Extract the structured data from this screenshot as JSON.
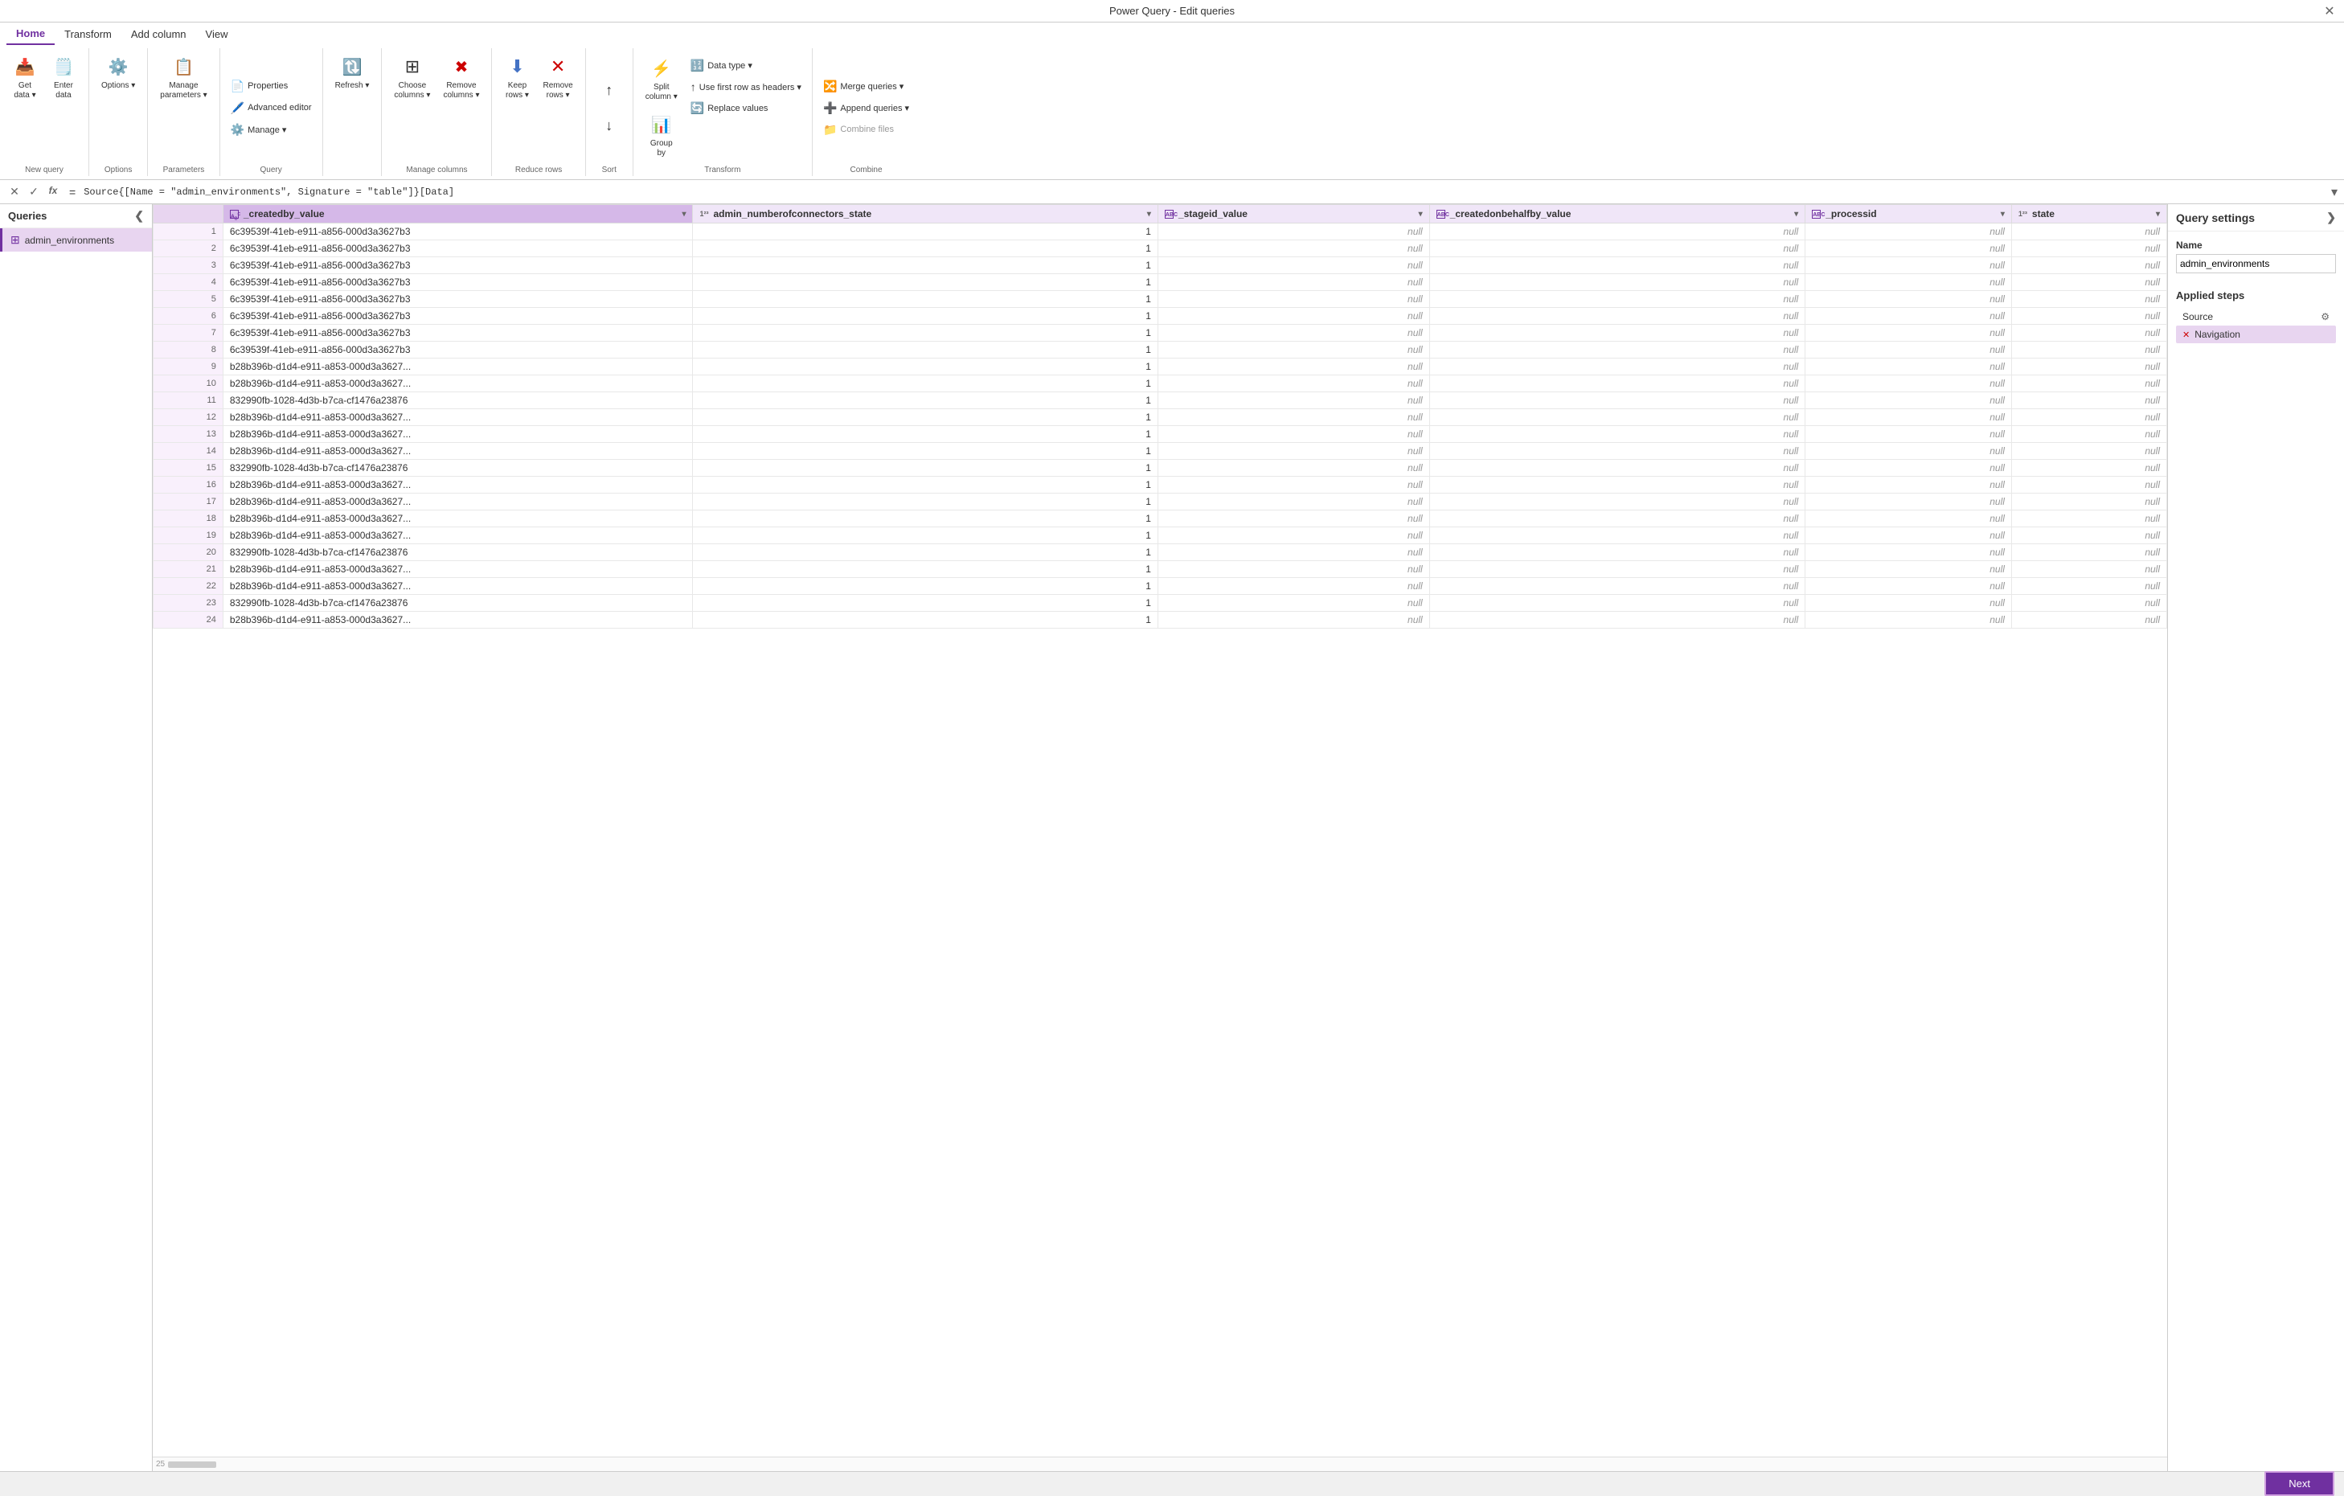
{
  "titleBar": {
    "title": "Power Query - Edit queries",
    "closeBtn": "✕"
  },
  "ribbonTabs": [
    {
      "id": "home",
      "label": "Home",
      "active": true
    },
    {
      "id": "transform",
      "label": "Transform",
      "active": false
    },
    {
      "id": "add-column",
      "label": "Add column",
      "active": false
    },
    {
      "id": "view",
      "label": "View",
      "active": false
    }
  ],
  "ribbon": {
    "groups": [
      {
        "id": "new-query",
        "label": "New query",
        "items": [
          {
            "id": "get-data",
            "icon": "📥",
            "label": "Get\ndata",
            "dropdown": true
          },
          {
            "id": "enter-data",
            "icon": "🗒️",
            "label": "Enter\ndata"
          }
        ]
      },
      {
        "id": "options",
        "label": "Options",
        "items": [
          {
            "id": "options-btn",
            "icon": "⚙️",
            "label": "Options",
            "dropdown": true
          }
        ]
      },
      {
        "id": "parameters",
        "label": "Parameters",
        "items": [
          {
            "id": "manage-parameters",
            "icon": "📋",
            "label": "Manage\nparameters",
            "dropdown": true
          }
        ]
      },
      {
        "id": "query-group",
        "label": "Query",
        "items_col1": [
          {
            "id": "properties",
            "icon": "📄",
            "label": "Properties"
          },
          {
            "id": "advanced-editor",
            "icon": "🖊️",
            "label": "Advanced editor"
          },
          {
            "id": "manage",
            "icon": "⚙️",
            "label": "Manage ▾"
          }
        ]
      },
      {
        "id": "manage-cols",
        "label": "Manage columns",
        "items": [
          {
            "id": "choose-columns",
            "icon": "🔲",
            "label": "Choose\ncolumns",
            "dropdown": true
          },
          {
            "id": "remove-columns",
            "icon": "✖️",
            "label": "Remove\ncolumns",
            "dropdown": true
          }
        ]
      },
      {
        "id": "reduce-rows",
        "label": "Reduce rows",
        "items": [
          {
            "id": "keep-rows",
            "icon": "⬇️",
            "label": "Keep\nrows",
            "dropdown": true
          },
          {
            "id": "remove-rows",
            "icon": "❌",
            "label": "Remove\nrows",
            "dropdown": true
          }
        ]
      },
      {
        "id": "sort-group",
        "label": "Sort",
        "items": [
          {
            "id": "sort-asc",
            "icon": "↑",
            "label": ""
          },
          {
            "id": "sort-desc",
            "icon": "↓",
            "label": ""
          }
        ]
      },
      {
        "id": "transform-group",
        "label": "Transform",
        "items_col1": [
          {
            "id": "split-column",
            "icon": "⚡",
            "label": "Split\ncolumn",
            "dropdown": true
          },
          {
            "id": "group-by",
            "icon": "📊",
            "label": "Group\nby"
          }
        ],
        "items_col2": [
          {
            "id": "data-type",
            "icon": "🔢",
            "label": "Data type ▾"
          },
          {
            "id": "first-row-headers",
            "icon": "↑",
            "label": "Use first row as headers ▾"
          },
          {
            "id": "replace-values",
            "icon": "🔄",
            "label": "Replace values"
          }
        ]
      },
      {
        "id": "combine-group",
        "label": "Combine",
        "items_col": [
          {
            "id": "merge-queries",
            "icon": "🔀",
            "label": "Merge queries ▾"
          },
          {
            "id": "append-queries",
            "icon": "➕",
            "label": "Append queries ▾"
          },
          {
            "id": "combine-files",
            "icon": "📁",
            "label": "Combine files"
          }
        ]
      },
      {
        "id": "refresh-group",
        "label": "",
        "items": [
          {
            "id": "refresh-btn",
            "icon": "🔃",
            "label": "Refresh",
            "dropdown": true
          }
        ]
      }
    ]
  },
  "formulaBar": {
    "cancelIcon": "✕",
    "confirmIcon": "✓",
    "functionIcon": "fx",
    "equals": "=",
    "formula": "Source{[Name = \"admin_environments\", Signature = \"table\"]}[Data]",
    "expandIcon": "▾"
  },
  "queriesPanel": {
    "title": "Queries",
    "collapseIcon": "❮",
    "items": [
      {
        "id": "admin-env",
        "icon": "⊞",
        "label": "admin_environments"
      }
    ]
  },
  "dataGrid": {
    "columns": [
      {
        "id": "createdby_value",
        "type": "ABC",
        "label": "_createdby_value"
      },
      {
        "id": "admin_numberofconnectors_state",
        "type": "123",
        "label": "admin_numberofconnectors_state"
      },
      {
        "id": "stageid_value",
        "type": "ABC",
        "label": "_stageid_value"
      },
      {
        "id": "createdonbehalfby_value",
        "type": "ABC",
        "label": "_createdonbehalfby_value"
      },
      {
        "id": "processid",
        "type": "ABC",
        "label": "_processid"
      },
      {
        "id": "state",
        "type": "123",
        "label": "state"
      }
    ],
    "rows": [
      {
        "num": 1,
        "createdby_value": "6c39539f-41eb-e911-a856-000d3a3627b3",
        "admin_numberofconnectors_state": "1",
        "stageid_value": "null",
        "createdonbehalfby_value": "null",
        "processid": "null",
        "state": "null"
      },
      {
        "num": 2,
        "createdby_value": "6c39539f-41eb-e911-a856-000d3a3627b3",
        "admin_numberofconnectors_state": "1",
        "stageid_value": "null",
        "createdonbehalfby_value": "null",
        "processid": "null",
        "state": "null"
      },
      {
        "num": 3,
        "createdby_value": "6c39539f-41eb-e911-a856-000d3a3627b3",
        "admin_numberofconnectors_state": "1",
        "stageid_value": "null",
        "createdonbehalfby_value": "null",
        "processid": "null",
        "state": "null"
      },
      {
        "num": 4,
        "createdby_value": "6c39539f-41eb-e911-a856-000d3a3627b3",
        "admin_numberofconnectors_state": "1",
        "stageid_value": "null",
        "createdonbehalfby_value": "null",
        "processid": "null",
        "state": "null"
      },
      {
        "num": 5,
        "createdby_value": "6c39539f-41eb-e911-a856-000d3a3627b3",
        "admin_numberofconnectors_state": "1",
        "stageid_value": "null",
        "createdonbehalfby_value": "null",
        "processid": "null",
        "state": "null"
      },
      {
        "num": 6,
        "createdby_value": "6c39539f-41eb-e911-a856-000d3a3627b3",
        "admin_numberofconnectors_state": "1",
        "stageid_value": "null",
        "createdonbehalfby_value": "null",
        "processid": "null",
        "state": "null"
      },
      {
        "num": 7,
        "createdby_value": "6c39539f-41eb-e911-a856-000d3a3627b3",
        "admin_numberofconnectors_state": "1",
        "stageid_value": "null",
        "createdonbehalfby_value": "null",
        "processid": "null",
        "state": "null"
      },
      {
        "num": 8,
        "createdby_value": "6c39539f-41eb-e911-a856-000d3a3627b3",
        "admin_numberofconnectors_state": "1",
        "stageid_value": "null",
        "createdonbehalfby_value": "null",
        "processid": "null",
        "state": "null"
      },
      {
        "num": 9,
        "createdby_value": "b28b396b-d1d4-e911-a853-000d3a3627...",
        "admin_numberofconnectors_state": "1",
        "stageid_value": "null",
        "createdonbehalfby_value": "null",
        "processid": "null",
        "state": "null"
      },
      {
        "num": 10,
        "createdby_value": "b28b396b-d1d4-e911-a853-000d3a3627...",
        "admin_numberofconnectors_state": "1",
        "stageid_value": "null",
        "createdonbehalfby_value": "null",
        "processid": "null",
        "state": "null"
      },
      {
        "num": 11,
        "createdby_value": "832990fb-1028-4d3b-b7ca-cf1476a23876",
        "admin_numberofconnectors_state": "1",
        "stageid_value": "null",
        "createdonbehalfby_value": "null",
        "processid": "null",
        "state": "null"
      },
      {
        "num": 12,
        "createdby_value": "b28b396b-d1d4-e911-a853-000d3a3627...",
        "admin_numberofconnectors_state": "1",
        "stageid_value": "null",
        "createdonbehalfby_value": "null",
        "processid": "null",
        "state": "null"
      },
      {
        "num": 13,
        "createdby_value": "b28b396b-d1d4-e911-a853-000d3a3627...",
        "admin_numberofconnectors_state": "1",
        "stageid_value": "null",
        "createdonbehalfby_value": "null",
        "processid": "null",
        "state": "null"
      },
      {
        "num": 14,
        "createdby_value": "b28b396b-d1d4-e911-a853-000d3a3627...",
        "admin_numberofconnectors_state": "1",
        "stageid_value": "null",
        "createdonbehalfby_value": "null",
        "processid": "null",
        "state": "null"
      },
      {
        "num": 15,
        "createdby_value": "832990fb-1028-4d3b-b7ca-cf1476a23876",
        "admin_numberofconnectors_state": "1",
        "stageid_value": "null",
        "createdonbehalfby_value": "null",
        "processid": "null",
        "state": "null"
      },
      {
        "num": 16,
        "createdby_value": "b28b396b-d1d4-e911-a853-000d3a3627...",
        "admin_numberofconnectors_state": "1",
        "stageid_value": "null",
        "createdonbehalfby_value": "null",
        "processid": "null",
        "state": "null"
      },
      {
        "num": 17,
        "createdby_value": "b28b396b-d1d4-e911-a853-000d3a3627...",
        "admin_numberofconnectors_state": "1",
        "stageid_value": "null",
        "createdonbehalfby_value": "null",
        "processid": "null",
        "state": "null"
      },
      {
        "num": 18,
        "createdby_value": "b28b396b-d1d4-e911-a853-000d3a3627...",
        "admin_numberofconnectors_state": "1",
        "stageid_value": "null",
        "createdonbehalfby_value": "null",
        "processid": "null",
        "state": "null"
      },
      {
        "num": 19,
        "createdby_value": "b28b396b-d1d4-e911-a853-000d3a3627...",
        "admin_numberofconnectors_state": "1",
        "stageid_value": "null",
        "createdonbehalfby_value": "null",
        "processid": "null",
        "state": "null"
      },
      {
        "num": 20,
        "createdby_value": "832990fb-1028-4d3b-b7ca-cf1476a23876",
        "admin_numberofconnectors_state": "1",
        "stageid_value": "null",
        "createdonbehalfby_value": "null",
        "processid": "null",
        "state": "null"
      },
      {
        "num": 21,
        "createdby_value": "b28b396b-d1d4-e911-a853-000d3a3627...",
        "admin_numberofconnectors_state": "1",
        "stageid_value": "null",
        "createdonbehalfby_value": "null",
        "processid": "null",
        "state": "null"
      },
      {
        "num": 22,
        "createdby_value": "b28b396b-d1d4-e911-a853-000d3a3627...",
        "admin_numberofconnectors_state": "1",
        "stageid_value": "null",
        "createdonbehalfby_value": "null",
        "processid": "null",
        "state": "null"
      },
      {
        "num": 23,
        "createdby_value": "832990fb-1028-4d3b-b7ca-cf1476a23876",
        "admin_numberofconnectors_state": "1",
        "stageid_value": "null",
        "createdonbehalfby_value": "null",
        "processid": "null",
        "state": "null"
      },
      {
        "num": 24,
        "createdby_value": "b28b396b-d1d4-e911-a853-000d3a3627...",
        "admin_numberofconnectors_state": "1",
        "stageid_value": "null",
        "createdonbehalfby_value": "null",
        "processid": "null",
        "state": "null"
      }
    ]
  },
  "querySettings": {
    "title": "Query settings",
    "expandIcon": "❯",
    "nameSectionLabel": "Name",
    "nameValue": "admin_environments",
    "appliedStepsLabel": "Applied steps",
    "steps": [
      {
        "id": "source",
        "label": "Source",
        "hasGear": true,
        "isActive": false
      },
      {
        "id": "navigation",
        "label": "Navigation",
        "hasDelete": true,
        "isActive": true
      }
    ]
  },
  "statusBar": {
    "nextBtnLabel": "Next"
  }
}
